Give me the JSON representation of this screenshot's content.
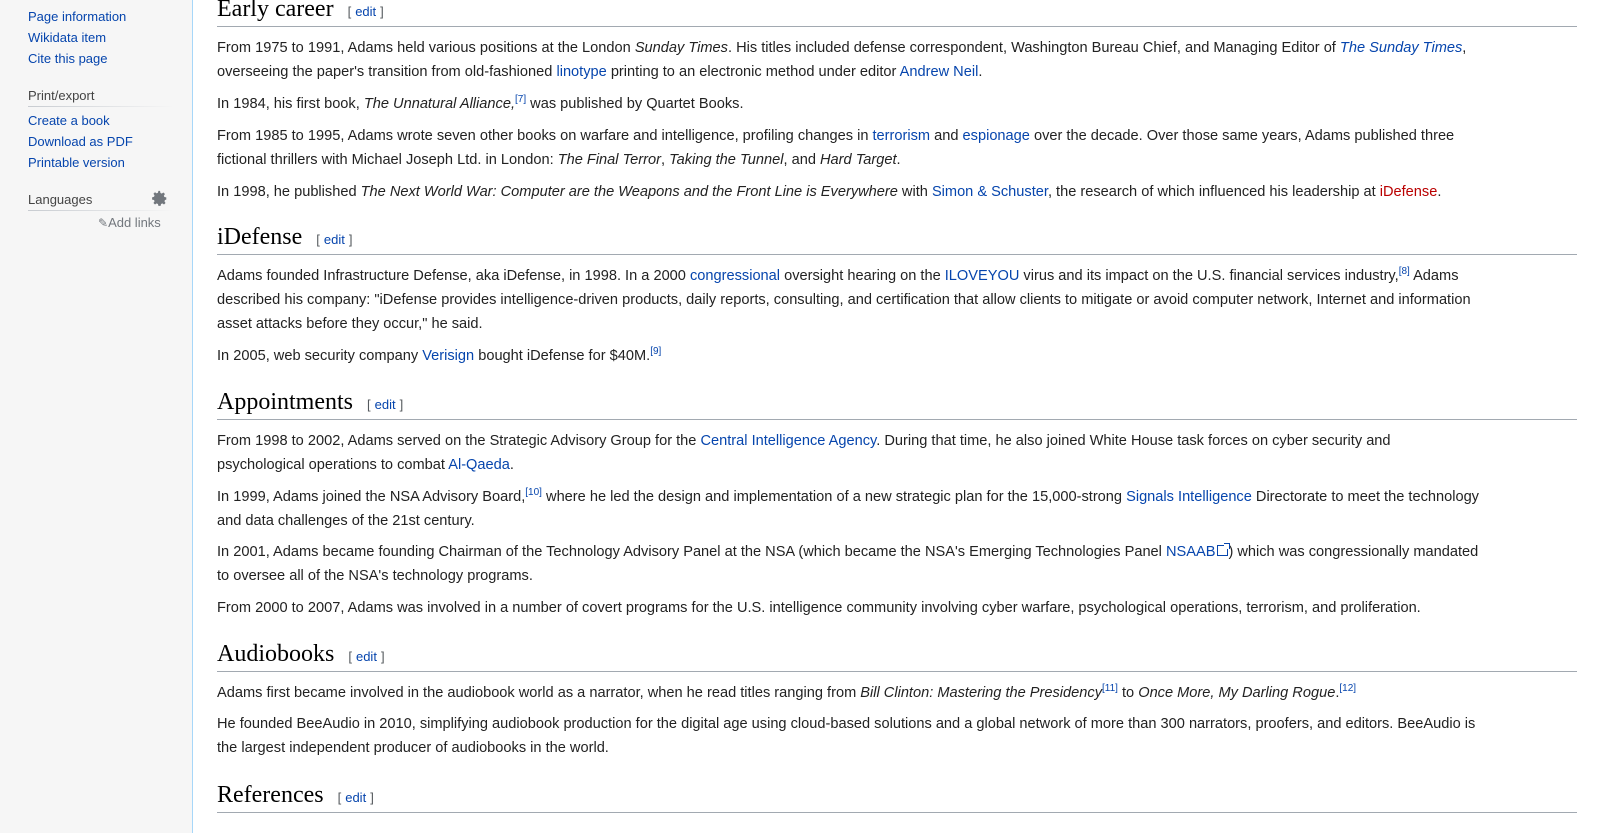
{
  "sidebar": {
    "tools": [
      {
        "label": "Page information"
      },
      {
        "label": "Wikidata item"
      },
      {
        "label": "Cite this page"
      }
    ],
    "print_heading": "Print/export",
    "print_items": [
      {
        "label": "Create a book"
      },
      {
        "label": "Download as PDF"
      },
      {
        "label": "Printable version"
      }
    ],
    "languages_heading": "Languages",
    "add_links": "Add links"
  },
  "edit_label": "edit",
  "sections": {
    "early_career": {
      "title": "Early career",
      "p1": [
        "From 1975 to 1991, Adams held various positions at the London ",
        "Sunday Times",
        ". His titles included defense correspondent, Washington Bureau Chief, and Managing Editor of ",
        "The Sunday Times",
        ",",
        "overseeing the paper's transition from old-fashioned ",
        "linotype",
        " printing to an electronic method under editor ",
        "Andrew Neil",
        "."
      ],
      "p2": [
        "In 1984, his first book, ",
        "The Unnatural Alliance,",
        "[7]",
        " was published by Quartet Books."
      ],
      "p3": [
        "From 1985 to 1995, Adams wrote seven other books on warfare and intelligence, profiling changes in ",
        "terrorism",
        " and ",
        "espionage",
        " over the decade. Over those same years, Adams published three",
        "fictional thrillers with Michael Joseph Ltd. in London: ",
        "The Final Terror",
        ", ",
        "Taking the Tunnel",
        ", and ",
        "Hard Target",
        "."
      ],
      "p4": [
        "In 1998, he published ",
        "The Next World War: Computer are the Weapons and the Front Line is Everywhere",
        " with ",
        "Simon & Schuster",
        ", the research of which influenced his leadership at ",
        "iDefense",
        "."
      ]
    },
    "idefense": {
      "title": "iDefense",
      "p1": [
        "Adams founded Infrastructure Defense, aka iDefense, in 1998. In a 2000 ",
        "congressional",
        " oversight hearing on the ",
        "ILOVEYOU",
        " virus and its impact on the U.S. financial services industry,",
        "[8]",
        " Adams",
        "described his company: \"iDefense provides intelligence-driven products, daily reports, consulting, and certification that allow clients to mitigate or avoid computer network, Internet and information",
        "asset attacks before they occur,\" he said."
      ],
      "p2": [
        "In 2005, web security company ",
        "Verisign",
        " bought iDefense for $40M.",
        "[9]"
      ]
    },
    "appointments": {
      "title": "Appointments",
      "p1": [
        "From 1998 to 2002, Adams served on the Strategic Advisory Group for the ",
        "Central Intelligence Agency",
        ". During that time, he also joined White House task forces on cyber security and",
        "psychological operations to combat ",
        "Al-Qaeda",
        "."
      ],
      "p2": [
        "In 1999, Adams joined the NSA Advisory Board,",
        "[10]",
        " where he led the design and implementation of a new strategic plan for the 15,000-strong ",
        "Signals Intelligence",
        " Directorate to meet the technology",
        "and data challenges of the 21st century."
      ],
      "p3": [
        "In 2001, Adams became founding Chairman of the Technology Advisory Panel at the NSA (which became the NSA's Emerging Technologies Panel ",
        "NSAAB",
        ") which was congressionally mandated",
        "to oversee all of the NSA's technology programs."
      ],
      "p4": [
        "From 2000 to 2007, Adams was involved in a number of covert programs for the U.S. intelligence community involving cyber warfare, psychological operations, terrorism, and proliferation."
      ]
    },
    "audiobooks": {
      "title": "Audiobooks",
      "p1": [
        "Adams first became involved in the audiobook world as a narrator, when he read titles ranging from ",
        "Bill Clinton: Mastering the Presidency",
        "[11]",
        " to ",
        "Once More, My Darling Rogue",
        ".",
        "[12]"
      ],
      "p2": [
        "He founded BeeAudio in 2010, simplifying audiobook production for the digital age using cloud-based solutions and a global network of more than 300 narrators, proofers, and editors. BeeAudio is",
        "the largest independent producer of audiobooks in the world."
      ]
    },
    "references": {
      "title": "References"
    }
  }
}
